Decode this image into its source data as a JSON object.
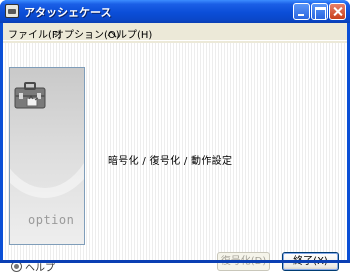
{
  "window": {
    "title": "アタッシェケース",
    "controls": [
      "minimize",
      "maximize",
      "close"
    ]
  },
  "menu": {
    "file": "ファイル(F)",
    "option": "オプション(O)",
    "help": "ヘルプ(H)"
  },
  "panel": {
    "label": "option",
    "icon": "attache-case-icon"
  },
  "main": {
    "description": "暗号化 / 復号化 / 動作設定"
  },
  "footer": {
    "help_label": "ヘルプ",
    "decrypt_button": "復号化(D)",
    "exit_button": "終了(X)"
  },
  "colors": {
    "title_bar": "#0a4fd6",
    "window_bg": "#ece9d8",
    "disabled_text": "#a4a197"
  }
}
